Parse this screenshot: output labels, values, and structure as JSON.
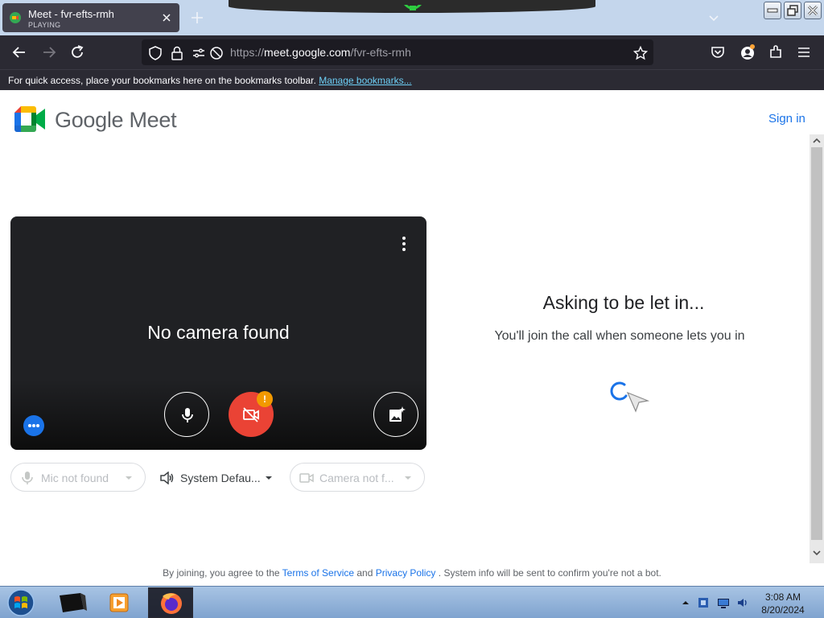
{
  "browser": {
    "tab": {
      "title": "Meet - fvr-efts-rmh",
      "subtitle": "PLAYING"
    },
    "url": {
      "prefix": "https://",
      "host": "meet.google.com",
      "path": "/fvr-efts-rmh"
    },
    "bookmarks_bar": {
      "message": "For quick access, place your bookmarks here on the bookmarks toolbar.",
      "link": "Manage bookmarks..."
    }
  },
  "page": {
    "brand": "Google Meet",
    "sign_in": "Sign in",
    "preview": {
      "message": "No camera found",
      "camera_badge": "!"
    },
    "devices": {
      "mic": "Mic not found",
      "speaker": "System Defau...",
      "camera": "Camera not f..."
    },
    "waiting": {
      "title": "Asking to be let in...",
      "subtitle": "You'll join the call when someone lets you in"
    },
    "footer": {
      "prefix": "By joining, you agree to the",
      "terms": "Terms of Service",
      "and": "and",
      "privacy": "Privacy Policy",
      "suffix": ". System info will be sent to confirm you're not a bot."
    }
  },
  "taskbar": {
    "clock_time": "3:08 AM",
    "clock_date": "8/20/2024"
  },
  "colors": {
    "accent": "#1a73e8",
    "danger": "#ea4335",
    "warning": "#f29900"
  }
}
